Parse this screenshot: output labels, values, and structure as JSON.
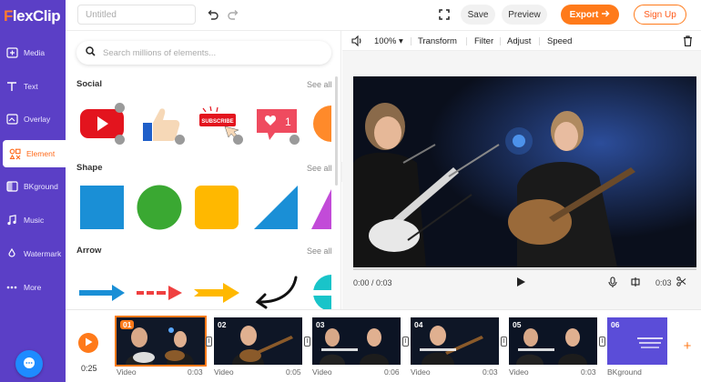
{
  "brand": {
    "logo_prefix": "F",
    "logo_rest": "lexClip",
    "accent": "#ff7a1a",
    "sidebar_bg": "#5b3fc6"
  },
  "topbar": {
    "title_placeholder": "Untitled",
    "undo_icon": "undo-icon",
    "redo_icon": "redo-icon",
    "fullscreen_icon": "fullscreen-icon",
    "save_label": "Save",
    "preview_label": "Preview",
    "export_label": "Export",
    "signup_label": "Sign Up"
  },
  "sidebar": {
    "items": [
      {
        "label": "Media",
        "icon": "media-icon"
      },
      {
        "label": "Text",
        "icon": "text-icon"
      },
      {
        "label": "Overlay",
        "icon": "overlay-icon"
      },
      {
        "label": "Element",
        "icon": "element-icon",
        "active": true
      },
      {
        "label": "BKground",
        "icon": "background-icon"
      },
      {
        "label": "Music",
        "icon": "music-icon"
      },
      {
        "label": "Watermark",
        "icon": "watermark-icon"
      },
      {
        "label": "More",
        "icon": "more-icon"
      }
    ]
  },
  "panel": {
    "search_placeholder": "Search millions of elements...",
    "sections": [
      {
        "title": "Social",
        "see_all": "See all"
      },
      {
        "title": "Shape",
        "see_all": "See all"
      },
      {
        "title": "Arrow",
        "see_all": "See all"
      }
    ],
    "social_items": [
      "youtube-icon",
      "thumbs-up-icon",
      "subscribe-icon",
      "like-notification-icon",
      "partial-icon"
    ],
    "subscribe_text": "SUBSCRIBE",
    "like_count": "1",
    "shape_items": [
      "square-shape",
      "circle-shape",
      "rounded-square-shape",
      "triangle-shape",
      "partial-triangle-shape"
    ],
    "shape_colors": [
      "#1a8fd6",
      "#3aa832",
      "#ffb800",
      "#1a8fd6",
      "#c24bd8"
    ],
    "arrow_items": [
      "blue-arrow",
      "red-dashed-arrow",
      "yellow-arrow",
      "black-curved-arrow",
      "teal-partial-arrow"
    ]
  },
  "preview": {
    "volume_icon": "volume-icon",
    "zoom": "100%",
    "tools": [
      "Transform",
      "Filter",
      "Adjust",
      "Speed"
    ],
    "delete_icon": "trash-icon",
    "current_time": "0:00 / 0:03",
    "clip_duration": "0:03"
  },
  "timeline": {
    "total_time": "0:25",
    "clips": [
      {
        "num": "01",
        "type": "Video",
        "duration": "0:03",
        "selected": true
      },
      {
        "num": "02",
        "type": "Video",
        "duration": "0:05"
      },
      {
        "num": "03",
        "type": "Video",
        "duration": "0:06"
      },
      {
        "num": "04",
        "type": "Video",
        "duration": "0:03"
      },
      {
        "num": "05",
        "type": "Video",
        "duration": "0:03"
      },
      {
        "num": "06",
        "type": "BKground",
        "duration": ""
      }
    ],
    "transition_glyph": "I",
    "add_label": "+"
  }
}
